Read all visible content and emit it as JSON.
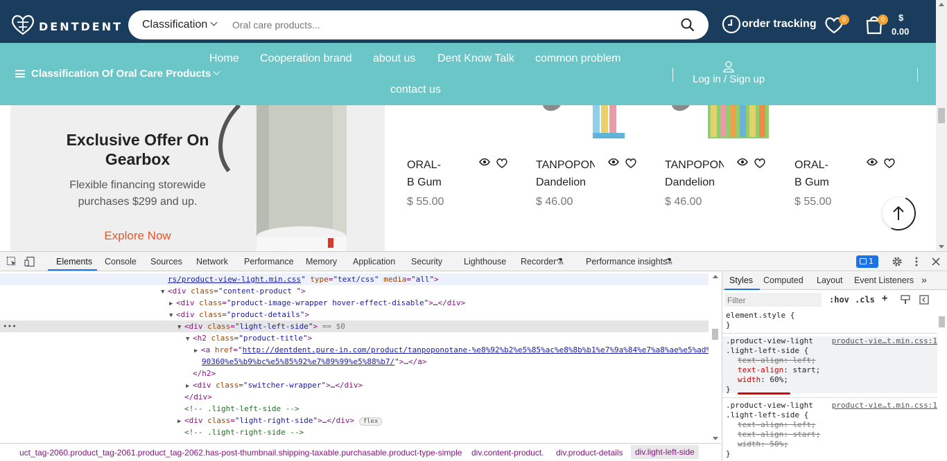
{
  "header": {
    "logo_text": "DENTDENT",
    "search_category": "Classification",
    "search_placeholder": "Oral care products...",
    "order_tracking": "order tracking",
    "wishlist_count": "0",
    "cart_count": "0",
    "cart_currency": "$",
    "cart_total": "0.00"
  },
  "nav": {
    "category_menu": "Classification Of Oral Care Products",
    "links": [
      "Home",
      "Cooperation brand",
      "about us",
      "Dent Know Talk",
      "common problem",
      "contact us"
    ],
    "login": "Log in / Sign up"
  },
  "promo": {
    "title": "Exclusive Offer On Gearbox",
    "subtitle": "Flexible financing storewide purchases $299 and up.",
    "cta": "Explore Now"
  },
  "products": [
    {
      "name_line1": "ORAL-",
      "name_line2": "B Gum",
      "price": "$ 55.00"
    },
    {
      "name_line1": "TANPOPONOTANE",
      "name_line2": "Dandelion",
      "price": "$ 46.00"
    },
    {
      "name_line1": "TANPOPONOTANE",
      "name_line2": "Dandelion",
      "price": "$ 46.00"
    },
    {
      "name_line1": "ORAL-",
      "name_line2": "B Gum",
      "price": "$ 55.00"
    }
  ],
  "devtools": {
    "tabs": [
      "Elements",
      "Console",
      "Sources",
      "Network",
      "Performance",
      "Memory",
      "Application",
      "Security",
      "Lighthouse",
      "Recorder",
      "Performance insights"
    ],
    "issues_count": "1",
    "dom": {
      "l0_val": "rs/product-view-light.min.css",
      "l0_rest_attr1": "type",
      "l0_rest_val1": "\"text/css\"",
      "l0_rest_attr2": "media",
      "l0_rest_val2": "\"all\"",
      "l1": "content-product ",
      "l2": "product-image-wrapper hover-effect-disable",
      "l3": "product-details",
      "l4": "light-left-side",
      "l4_eq": "== $0",
      "l5": "product-title",
      "l6_href_a": "http://dentdent.pure-in.com/product/tanpoponotane-%e8%92%b2%e5%85%ac%e8%8b%b1%e7%9a%84%e7%a8%ae%e5%ad%",
      "l6_href_b": "90360%e5%b9%bc%e5%85%92%e7%89%99%e5%88%b7/",
      "l8": "switcher-wrapper",
      "l10_cmt": "<!-- .light-left-side -->",
      "l11": "light-right-side",
      "l11_badge": "flex",
      "l12_cmt": "<!-- .light-right-side -->"
    },
    "breadcrumb": [
      "uct_tag-2060.product_tag-2061.product_tag-2062.has-post-thumbnail.shipping-taxable.purchasable.product-type-simple",
      "div.content-product.",
      "div.product-details",
      "div.light-left-side"
    ],
    "styles_tabs": [
      "Styles",
      "Computed",
      "Layout",
      "Event Listeners"
    ],
    "filter_placeholder": "Filter",
    "hov": ":hov",
    "cls": ".cls",
    "rules": {
      "element_style": "element.style {",
      "close": "}",
      "r1_sel1": ".product-view-light",
      "r1_sel2": ".light-left-side {",
      "r1_src": "product-vie…t.min.css:1",
      "r1_p1": "text-align: left;",
      "r1_p2n": "text-align",
      "r1_p2v": "start;",
      "r1_p3n": "width",
      "r1_p3v": "60%;",
      "r2_sel1": ".product-view-light",
      "r2_sel2": ".light-left-side {",
      "r2_src": "product-vie…t.min.css:1",
      "r2_p1": "text-align: left;",
      "r2_p2": "text-align: start;",
      "r2_p3": "width: 50%;"
    }
  }
}
